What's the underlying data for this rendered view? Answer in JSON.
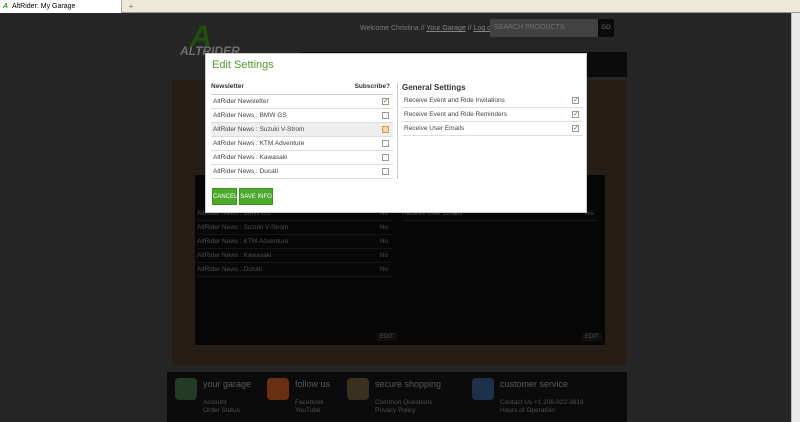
{
  "browser": {
    "tab_title": "AltRider: My Garage",
    "new_tab": "+"
  },
  "header": {
    "welcome": "Welcome Christina",
    "sep": "//",
    "your_garage": "Your Garage",
    "logout": "Log out",
    "search_placeholder": "SEARCH PRODUCTS",
    "go": "GO",
    "logo_letter": "A",
    "brand": "ALTRIDER"
  },
  "background": {
    "rows": [
      {
        "label": "AltRider News : BMW GS",
        "value": "No"
      },
      {
        "label": "AltRider News : Suzuki V-Strom",
        "value": "No"
      },
      {
        "label": "AltRider News : KTM Adventure",
        "value": "No"
      },
      {
        "label": "AltRider News : Kawasaki",
        "value": "No"
      },
      {
        "label": "AltRider News : Ducati",
        "value": "No"
      }
    ],
    "right_row": {
      "label": "Receive User Emails",
      "value": "Yes"
    },
    "edit": "EDIT"
  },
  "footer": [
    {
      "title": "your garage",
      "links": [
        "Account",
        "Order Status"
      ]
    },
    {
      "title": "follow us",
      "links": [
        "Facebook",
        "YouTube"
      ]
    },
    {
      "title": "secure shopping",
      "links": [
        "Common Questions",
        "Privacy Policy"
      ]
    },
    {
      "title": "customer service",
      "links": [
        "Contact Us    +1 206-922-3818",
        "Hours of Operation"
      ]
    }
  ],
  "modal": {
    "title": "Edit Settings",
    "newsletter_header": "Newsletter",
    "subscribe_header": "Subscribe?",
    "newsletters": [
      {
        "label": "AltRider Newsletter",
        "checked": true
      },
      {
        "label": "AltRider News : BMW GS",
        "checked": false
      },
      {
        "label": "AltRider News : Suzuki V-Strom",
        "checked": false
      },
      {
        "label": "AltRider News : KTM Adventure",
        "checked": false
      },
      {
        "label": "AltRider News : Kawasaki",
        "checked": false
      },
      {
        "label": "AltRider News : Ducati",
        "checked": false
      }
    ],
    "general_header": "General Settings",
    "general": [
      {
        "label": "Receive Event and Ride Invitations",
        "checked": true
      },
      {
        "label": "Receive Event and Ride Reminders",
        "checked": true
      },
      {
        "label": "Receive User Emails",
        "checked": true
      }
    ],
    "cancel": "CANCEL",
    "save": "SAVE INFO",
    "check_glyph": "✓"
  }
}
